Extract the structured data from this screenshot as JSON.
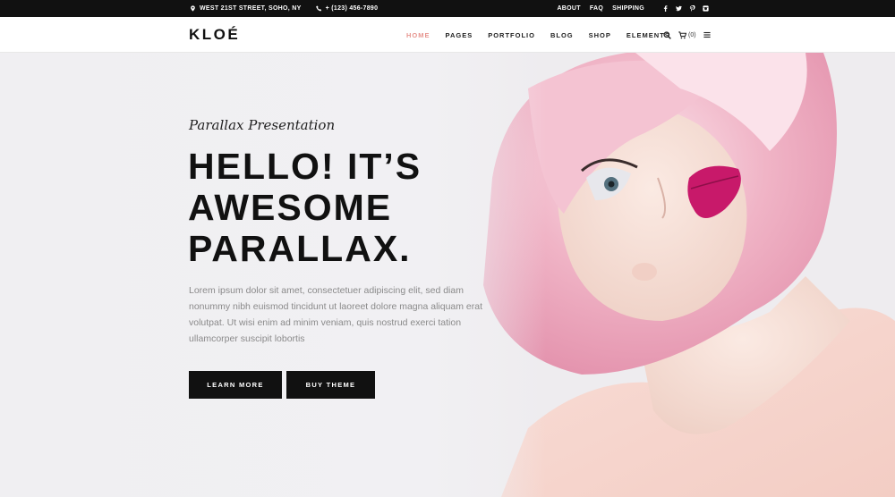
{
  "topbar": {
    "address": "WEST 21ST STREET, SOHO, NY",
    "phone": "+ (123) 456-7890",
    "links": [
      "ABOUT",
      "FAQ",
      "SHIPPING"
    ],
    "social": [
      "facebook-icon",
      "twitter-icon",
      "pinterest-icon",
      "instagram-icon"
    ]
  },
  "header": {
    "logo": "KLOÉ",
    "nav": [
      {
        "label": "HOME",
        "active": true
      },
      {
        "label": "PAGES",
        "active": false
      },
      {
        "label": "PORTFOLIO",
        "active": false
      },
      {
        "label": "BLOG",
        "active": false
      },
      {
        "label": "SHOP",
        "active": false
      },
      {
        "label": "ELEMENTS",
        "active": false
      }
    ],
    "cart_count": "(0)"
  },
  "hero": {
    "eyebrow": "Parallax Presentation",
    "headline": [
      "HELLO! IT’S",
      "AWESOME",
      "PARALLAX."
    ],
    "description": "Lorem ipsum dolor sit amet, consectetuer adipiscing elit, sed diam nonummy nibh euismod tincidunt ut laoreet dolore magna aliquam erat volutpat. Ut wisi enim ad minim veniam, quis nostrud exerci tation ullamcorper suscipit lobortis",
    "buttons": {
      "learn_more": "LEARN MORE",
      "buy_theme": "BUY THEME"
    }
  },
  "colors": {
    "accent": "#e7958f",
    "dark": "#111111",
    "hair": "#f0b3c5",
    "lips": "#c8196a"
  }
}
